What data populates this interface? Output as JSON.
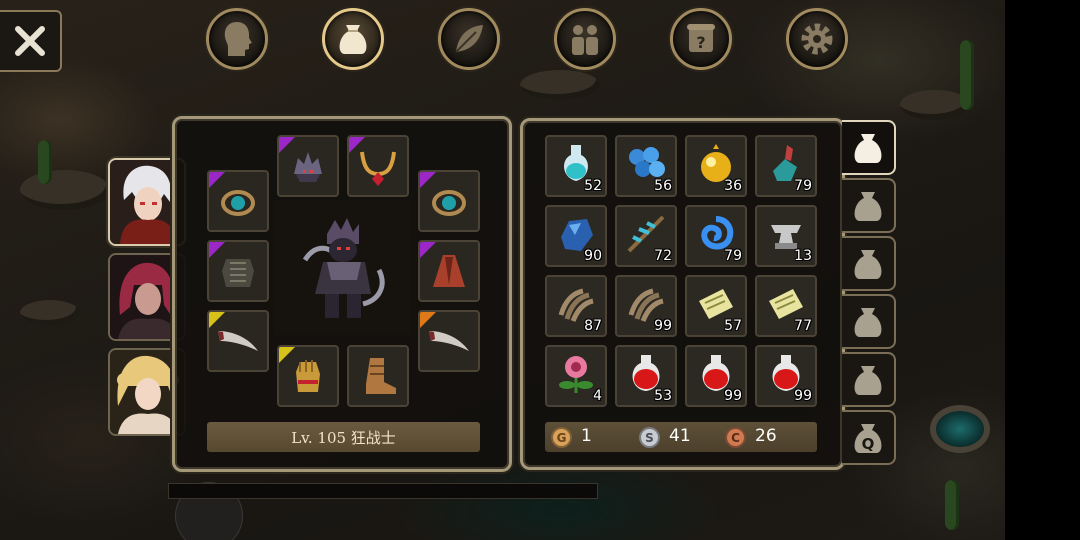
{
  "colors": {
    "frame": "#a59878",
    "rarity_purple": "#9b27c9",
    "rarity_yellow": "#d6c21a",
    "rarity_orange": "#e07a18"
  },
  "top_nav": [
    {
      "id": "character",
      "icon": "head-silhouette-icon",
      "active": false
    },
    {
      "id": "inventory",
      "icon": "bag-icon",
      "active": true
    },
    {
      "id": "skills",
      "icon": "leaf-icon",
      "active": false
    },
    {
      "id": "party",
      "icon": "party-icon",
      "active": false
    },
    {
      "id": "quest",
      "icon": "quest-scroll-icon",
      "active": false
    },
    {
      "id": "settings",
      "icon": "gear-icon",
      "active": false
    }
  ],
  "character": {
    "level_text": "Lv. 105 狂战士"
  },
  "equipment": [
    {
      "slot": "helmet",
      "icon": "dark-helmet-icon",
      "rarity": "purple"
    },
    {
      "slot": "necklace",
      "icon": "ruby-necklace-icon",
      "rarity": "purple"
    },
    {
      "slot": "ring-left",
      "icon": "teal-ring-icon",
      "rarity": "purple"
    },
    {
      "slot": "ring-right",
      "icon": "teal-ring-icon",
      "rarity": "purple"
    },
    {
      "slot": "armor",
      "icon": "chainmail-armor-icon",
      "rarity": "purple"
    },
    {
      "slot": "cloak",
      "icon": "red-cloak-icon",
      "rarity": "purple"
    },
    {
      "slot": "weapon-left",
      "icon": "curved-blade-icon",
      "rarity": "yellow"
    },
    {
      "slot": "weapon-right",
      "icon": "curved-blade-icon",
      "rarity": "orange"
    },
    {
      "slot": "gloves",
      "icon": "golden-gauntlet-icon",
      "rarity": "yellow"
    },
    {
      "slot": "boots",
      "icon": "leather-boot-icon",
      "rarity": "none"
    }
  ],
  "inventory": {
    "items": [
      {
        "icon": "cyan-potion-flask-icon",
        "count": "52"
      },
      {
        "icon": "blue-gem-cluster-icon",
        "count": "56"
      },
      {
        "icon": "golden-orb-icon",
        "count": "36"
      },
      {
        "icon": "teal-crystal-shard-icon",
        "count": "79"
      },
      {
        "icon": "blue-stone-icon",
        "count": "90"
      },
      {
        "icon": "crystal-staff-icon",
        "count": "72"
      },
      {
        "icon": "blue-swirl-icon",
        "count": "79"
      },
      {
        "icon": "iron-anvil-icon",
        "count": "13"
      },
      {
        "icon": "beast-claw-icon",
        "count": "87"
      },
      {
        "icon": "beast-claw-icon",
        "count": "99"
      },
      {
        "icon": "scroll-icon",
        "count": "57"
      },
      {
        "icon": "scroll-icon",
        "count": "77"
      },
      {
        "icon": "pink-flower-icon",
        "count": "4"
      },
      {
        "icon": "red-potion-icon",
        "count": "53"
      },
      {
        "icon": "red-potion-icon",
        "count": "99"
      },
      {
        "icon": "red-potion-icon",
        "count": "99"
      }
    ],
    "currency": [
      {
        "type": "gold",
        "symbol": "G",
        "value": "1",
        "color": "#d9a15a"
      },
      {
        "type": "silver",
        "symbol": "S",
        "value": "41",
        "color": "#c8ccd2"
      },
      {
        "type": "copper",
        "symbol": "C",
        "value": "26",
        "color": "#d07a52"
      }
    ]
  },
  "bag_tabs": [
    {
      "icon": "bag-icon",
      "active": true,
      "label": ""
    },
    {
      "icon": "bag-icon",
      "active": false,
      "label": ""
    },
    {
      "icon": "bag-icon",
      "active": false,
      "label": ""
    },
    {
      "icon": "bag-icon",
      "active": false,
      "label": ""
    },
    {
      "icon": "bag-icon",
      "active": false,
      "label": ""
    },
    {
      "icon": "quest-bag-icon",
      "active": false,
      "label": "Q"
    }
  ],
  "party_portraits": [
    {
      "name": "white-haired-warrior",
      "active": true
    },
    {
      "name": "red-haired-mage",
      "active": false
    },
    {
      "name": "blonde-priestess",
      "active": false
    }
  ]
}
